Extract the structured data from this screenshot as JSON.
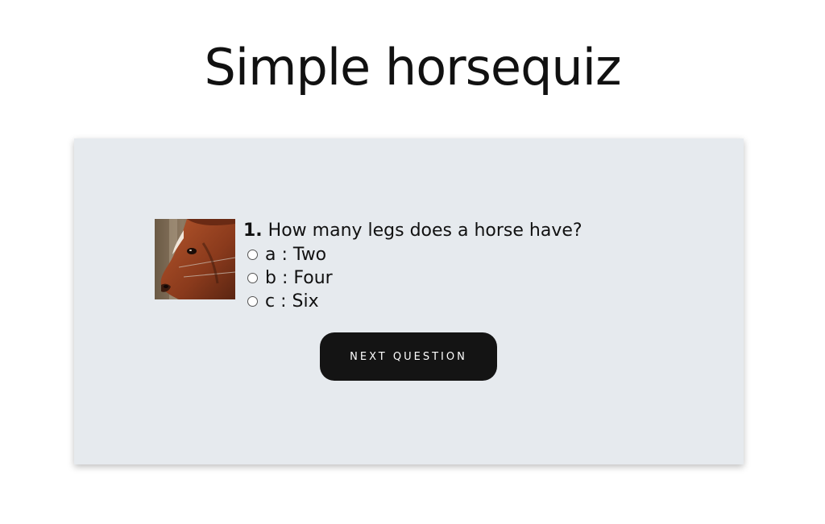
{
  "page": {
    "title": "Simple horsequiz"
  },
  "quiz": {
    "image_alt": "horse head photo",
    "question_number": "1.",
    "question_text": "How many legs does a horse have?",
    "answers": [
      {
        "letter": "a",
        "separator": " : ",
        "text": "Two",
        "selected": false
      },
      {
        "letter": "b",
        "separator": " : ",
        "text": "Four",
        "selected": false
      },
      {
        "letter": "c",
        "separator": " : ",
        "text": "Six",
        "selected": false
      }
    ],
    "next_button_label": "Next Question"
  },
  "colors": {
    "card_background": "#e6eaee",
    "button_background": "#141414",
    "button_text": "#ffffff",
    "title_text": "#111111"
  }
}
